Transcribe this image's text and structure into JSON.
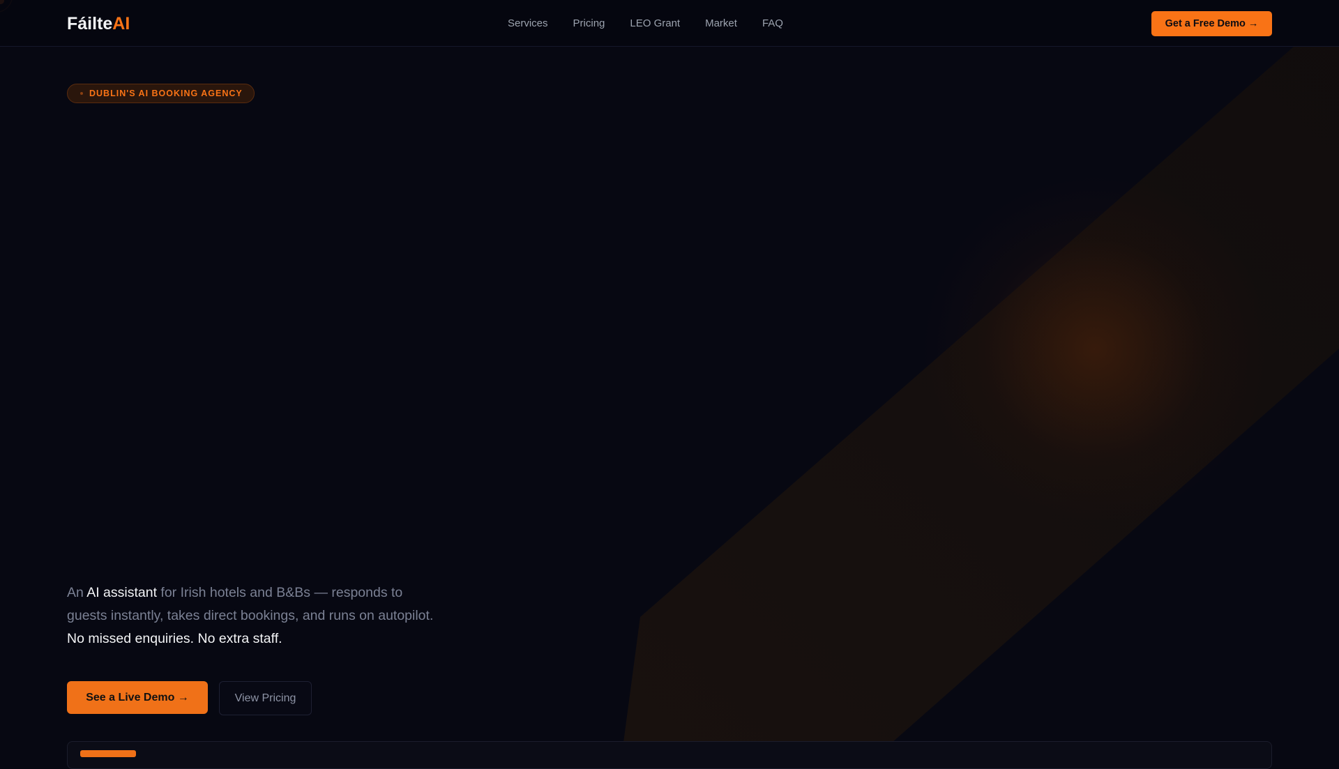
{
  "brand": {
    "name_part1": "Fáilte",
    "name_part2": "AI"
  },
  "nav": {
    "items": [
      "Services",
      "Pricing",
      "LEO Grant",
      "Market",
      "FAQ"
    ],
    "cta": "Get a Free Demo →"
  },
  "hero": {
    "badge": "DUBLIN'S AI BOOKING AGENCY",
    "desc_1": "An ",
    "desc_hl": "AI assistant",
    "desc_2": " for Irish hotels and B&Bs — responds to guests instantly, takes direct bookings, and runs on autopilot.",
    "desc_3": "No missed enquiries. No extra staff.",
    "primary_button": "See a Live Demo →",
    "secondary_button": "View Pricing"
  },
  "colors": {
    "accent": "#f97316",
    "background": "#070812"
  }
}
